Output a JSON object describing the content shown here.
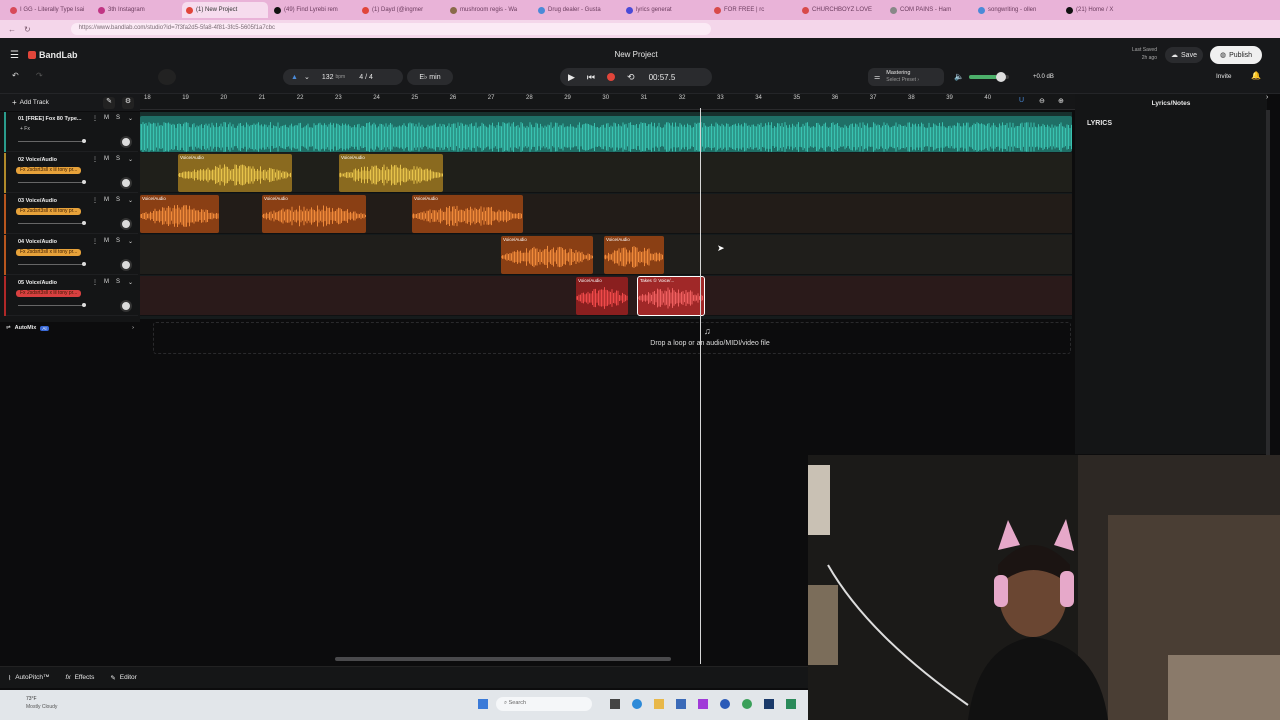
{
  "browser": {
    "tabs": [
      {
        "label": "I GG - Literally Type Isai",
        "color": "#d84a5a"
      },
      {
        "label": "3th Instagram",
        "color": "#c13584"
      },
      {
        "label": "(1) New Project",
        "color": "#e1453a"
      },
      {
        "label": "(49) Find Lyrebi rem",
        "color": "#111111"
      },
      {
        "label": "(1) Dayd (@ingmer",
        "color": "#e1453a"
      },
      {
        "label": "mushroom regis - Wa",
        "color": "#8a6a4a"
      },
      {
        "label": "Drug dealer - Gusta",
        "color": "#4a8ad8"
      },
      {
        "label": "lyrics generat",
        "color": "#4a4ad8"
      },
      {
        "label": "FOR FREE | rc",
        "color": "#d84a4a"
      },
      {
        "label": "CHURCHBOYZ LOVE",
        "color": "#d84a4a"
      },
      {
        "label": "COM PAINS - Ham",
        "color": "#888888"
      },
      {
        "label": "songwriting - ollen",
        "color": "#4a8ad8"
      },
      {
        "label": "(21) Home / X",
        "color": "#111111"
      }
    ],
    "url": "https://www.bandlab.com/studio?id=7f3fa2d5-5fa8-4f81-3fc5-5605f1a7cbc"
  },
  "app": {
    "brand": "BandLab",
    "project_title": "New Project",
    "last_saved_label": "Last Saved",
    "last_saved_value": "2h ago",
    "save_label": "Save",
    "publish_label": "Publish",
    "invite_label": "Invite"
  },
  "transport": {
    "bpm_value": "132",
    "bpm_unit": "bpm",
    "time_signature": "4 / 4",
    "key": "E♭ min",
    "time": "00:57.5",
    "mastering_label": "Mastering",
    "mastering_preset": "Select Preset ›",
    "volume_db": "+0.0 dB"
  },
  "toolbar": {
    "add_track_label": "Add Track"
  },
  "ruler": {
    "numbers": [
      "18",
      "19",
      "20",
      "21",
      "22",
      "23",
      "24",
      "25",
      "26",
      "27",
      "28",
      "29",
      "30",
      "31",
      "32",
      "33",
      "34",
      "35",
      "36",
      "37",
      "38",
      "39",
      "40"
    ]
  },
  "tracks": [
    {
      "name": "01  [FREE] Fox 80 Type...",
      "tag": "+ Fx",
      "tag_color": "",
      "color": "#2a9c8c"
    },
    {
      "name": "02  Voice/Audio",
      "tag": "Fx  2sdsrt3sll x lil tony pr...",
      "tag_color": "#e7a23a",
      "color": "#b08a2a"
    },
    {
      "name": "03  Voice/Audio",
      "tag": "Fx  2sdsrt3sll x lil tony pr...",
      "tag_color": "#e7a23a",
      "color": "#b8561e"
    },
    {
      "name": "04  Voice/Audio",
      "tag": "Fx  2sdsrt3sll x lil tony pr...",
      "tag_color": "#e7a23a",
      "color": "#b8561e"
    },
    {
      "name": "05  Voice/Audio",
      "tag": "Fx  2sdsrt3sll x lil tony pr...",
      "tag_color": "#d84040",
      "color": "#b02828"
    }
  ],
  "track_controls": {
    "mute": "M",
    "solo": "S"
  },
  "clips": {
    "label": "Voice/Audio",
    "split_label": "Takes ① Voice/..."
  },
  "automix": {
    "label": "AutoMix",
    "badge": "AI"
  },
  "dropzone": {
    "text": "Drop a loop or an audio/MIDI/video file"
  },
  "right_panel": {
    "header": "Lyrics/Notes",
    "section": "LYRICS"
  },
  "bottom_bar": {
    "autopitch": "AutoPitch™",
    "effects": "Effects",
    "editor": "Editor"
  },
  "taskbar": {
    "weather_temp": "73°F",
    "weather_text": "Mostly Cloudy",
    "search_placeholder": "Search"
  }
}
